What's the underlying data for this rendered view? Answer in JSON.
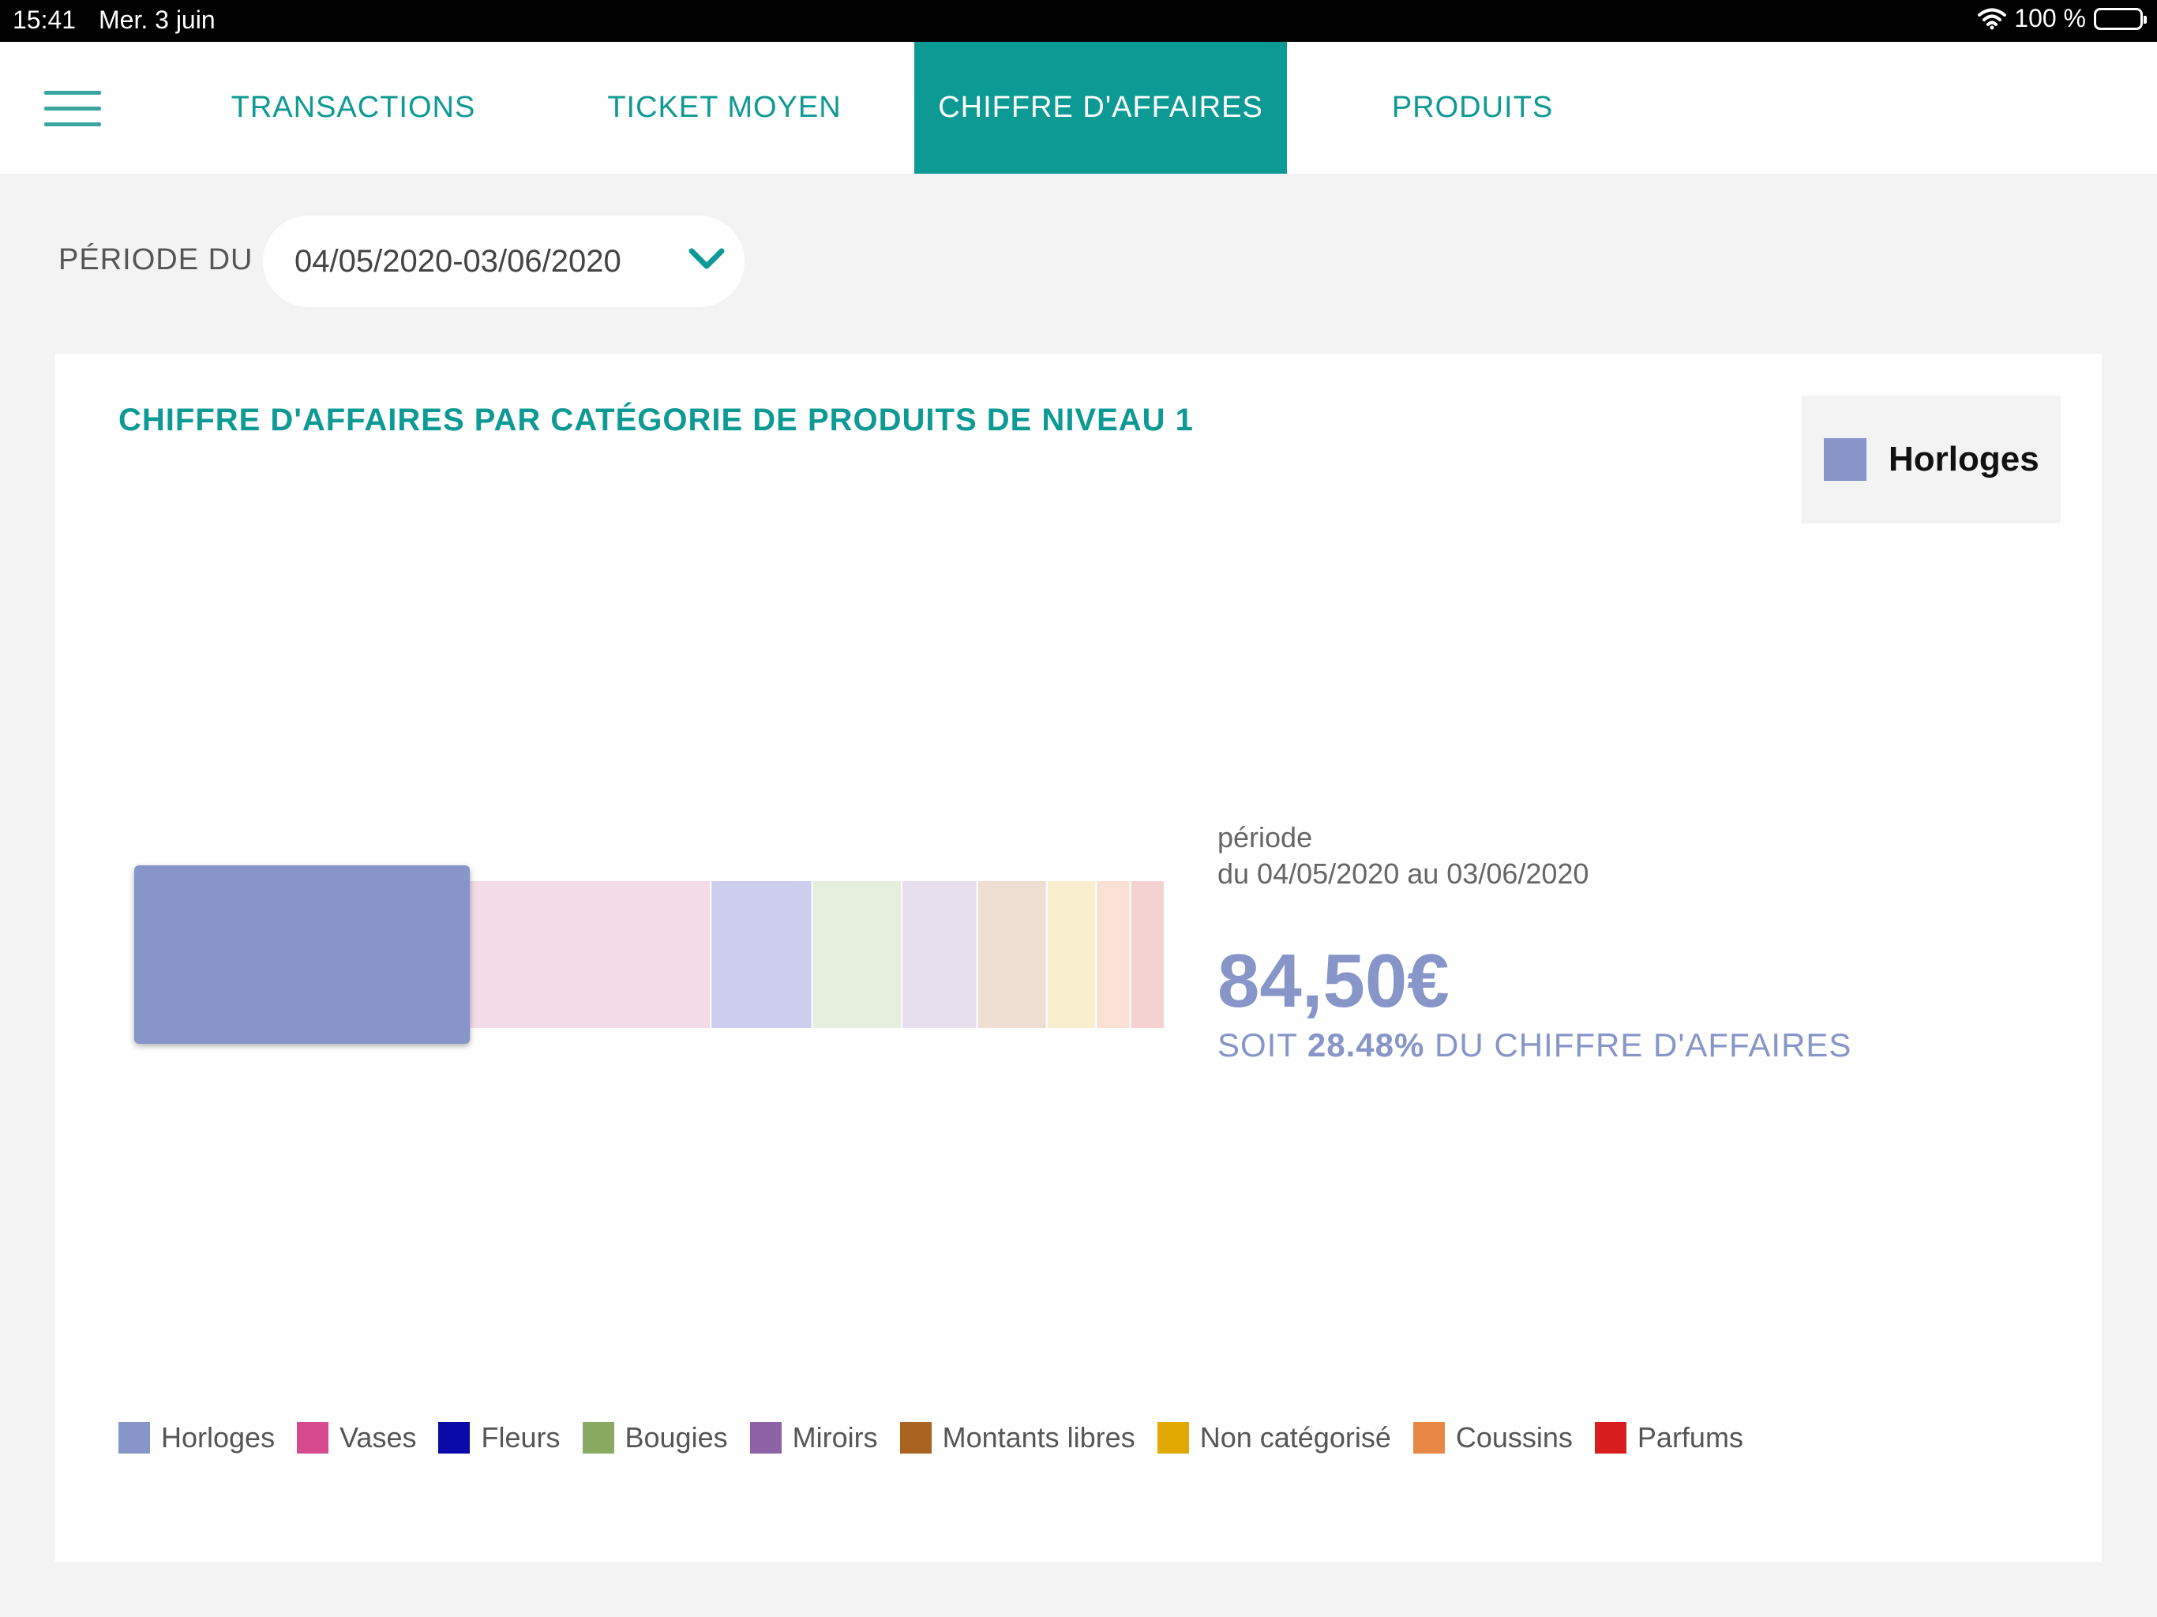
{
  "status_bar": {
    "time": "15:41",
    "date": "Mer. 3 juin",
    "battery": "100 %"
  },
  "nav": {
    "tabs": [
      {
        "label": "TRANSACTIONS",
        "active": false
      },
      {
        "label": "TICKET MOYEN",
        "active": false
      },
      {
        "label": "CHIFFRE D'AFFAIRES",
        "active": true
      },
      {
        "label": "PRODUITS",
        "active": false
      }
    ]
  },
  "period": {
    "label": "PÉRIODE DU",
    "value": "04/05/2020-03/06/2020"
  },
  "card": {
    "title": "CHIFFRE D'AFFAIRES PAR CATÉGORIE DE PRODUITS DE NIVEAU 1",
    "selected": {
      "name": "Horloges",
      "color": "#8795c8"
    },
    "info": {
      "period_line1": "période",
      "period_line2": "du 04/05/2020 au 03/06/2020",
      "amount": "84,50€",
      "share_prefix": "SOIT",
      "share_value": "28.48%",
      "share_suffix": "DU CHIFFRE D'AFFAIRES"
    }
  },
  "chart_data": {
    "type": "bar",
    "stacked": true,
    "orientation": "horizontal",
    "unit": "%",
    "selected_category": "Horloges",
    "series": [
      {
        "name": "Horloges",
        "value": 28.48,
        "color": "#8795c8",
        "light": "#8795c8"
      },
      {
        "name": "Vases",
        "value": 20.5,
        "color": "#d64a8e",
        "light": "#f4dbe8"
      },
      {
        "name": "Fleurs",
        "value": 8.6,
        "color": "#0a0aa8",
        "light": "#cdcdee"
      },
      {
        "name": "Bougies",
        "value": 7.6,
        "color": "#8aaa62",
        "light": "#e6eedd"
      },
      {
        "name": "Miroirs",
        "value": 6.4,
        "color": "#8e62a6",
        "light": "#e7dfee"
      },
      {
        "name": "Montants libres",
        "value": 5.9,
        "color": "#a86420",
        "light": "#eedfd2"
      },
      {
        "name": "Non catégorisé",
        "value": 4.2,
        "color": "#e0a800",
        "light": "#f8edcc"
      },
      {
        "name": "Coussins",
        "value": 2.9,
        "color": "#e88844",
        "light": "#f9e2d5"
      },
      {
        "name": "Parfums",
        "value": 2.9,
        "color": "#d81e1e",
        "light": "#f4d2d2"
      }
    ]
  }
}
